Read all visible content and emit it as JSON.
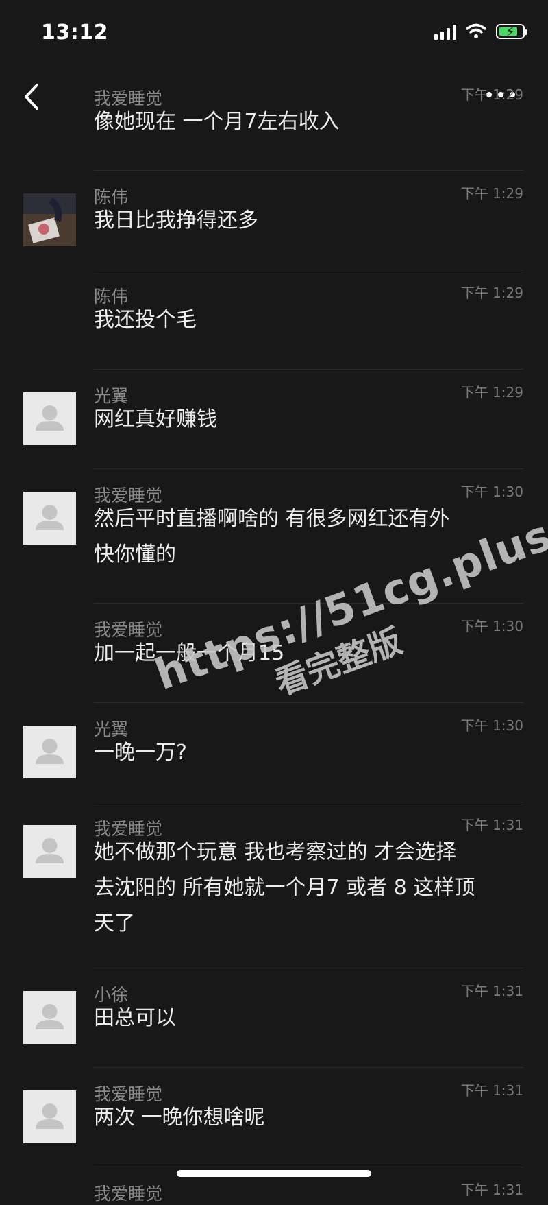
{
  "status": {
    "time": "13:12"
  },
  "messages": [
    {
      "name": "我爱睡觉",
      "time": "下午 1:29",
      "lines": [
        "像她现在 一个月7左右收入"
      ],
      "avatar": "none"
    },
    {
      "name": "陈伟",
      "time": "下午 1:29",
      "lines": [
        "我日比我挣得还多"
      ],
      "avatar": "photo"
    },
    {
      "name": "陈伟",
      "time": "下午 1:29",
      "lines": [
        "我还投个毛"
      ],
      "avatar": "none"
    },
    {
      "name": "光翼",
      "time": "下午 1:29",
      "lines": [
        "网红真好赚钱"
      ],
      "avatar": "default"
    },
    {
      "name": "我爱睡觉",
      "time": "下午 1:30",
      "lines": [
        "然后平时直播啊啥的 有很多网红还有外",
        "快你懂的"
      ],
      "avatar": "default"
    },
    {
      "name": "我爱睡觉",
      "time": "下午 1:30",
      "lines": [
        "加一起一般一个月15"
      ],
      "avatar": "none"
    },
    {
      "name": "光翼",
      "time": "下午 1:30",
      "lines": [
        "一晚一万?"
      ],
      "avatar": "default"
    },
    {
      "name": "我爱睡觉",
      "time": "下午 1:31",
      "lines": [
        "她不做那个玩意 我也考察过的 才会选择",
        "去沈阳的 所有她就一个月7 或者 8 这样顶",
        "天了"
      ],
      "avatar": "default"
    },
    {
      "name": "小徐",
      "time": "下午 1:31",
      "lines": [
        "田总可以"
      ],
      "avatar": "default"
    },
    {
      "name": "我爱睡觉",
      "time": "下午 1:31",
      "lines": [
        "两次 一晚你想啥呢"
      ],
      "avatar": "default"
    },
    {
      "name": "我爱睡觉",
      "time": "下午 1:31",
      "lines": [],
      "avatar": "none"
    }
  ],
  "watermark": {
    "line1": "https://51cg.plus",
    "line2": "看完整版"
  },
  "icons": {
    "back": "chevron-left-icon",
    "more": "more-dots-icon",
    "signal": "signal-icon",
    "wifi": "wifi-icon",
    "battery": "battery-charging-icon",
    "avatar": "default-avatar-icon"
  },
  "colors": {
    "background": "#181818",
    "battery_fill": "#4cd964"
  }
}
